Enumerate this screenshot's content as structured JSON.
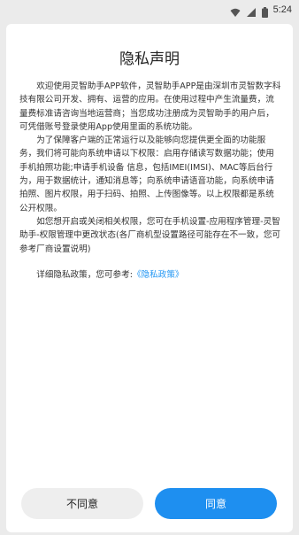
{
  "status_bar": {
    "time": "5:24",
    "icons": [
      "wifi-icon",
      "signal-icon",
      "battery-icon"
    ]
  },
  "dialog": {
    "title": "隐私声明",
    "paragraphs": [
      "欢迎使用灵智助手APP软件，灵智助手APP是由深圳市灵智数字科技有限公司开发、拥有、运营的应用。在使用过程中产生流量费，流量费标准请咨询当地运营商；当您成功注册成为灵智助手的用户后，可凭借账号登录使用App使用里面的系统功能。",
      "为了保障客户端的正常运行以及能够向您提供更全面的功能服务，我们将可能向系统申请以下权限：启用存储读写数据功能；使用手机拍照功能;申请手机设备 信息，包括IMEI(IMSI)、MAC等后台行为，用于数据统计，通知消息等；向系统申请语音功能，向系统申请拍照、图片权限，用于扫码、拍照、上传图像等。以上权限都是系统公开权限。",
      "如您想开启或关闭相关权限，您可在手机设置-应用程序管理-灵智助手-权限管理中更改状态(各厂商机型设置路径可能存在不一致，您可参考厂商设置说明)"
    ],
    "detail_prefix": "详细隐私政策，您可参考:",
    "detail_link": "《隐私政策》",
    "disagree_label": "不同意",
    "agree_label": "同意"
  },
  "colors": {
    "background": "#ebebeb",
    "dialog": "#ffffff",
    "accent": "#1e8ff0",
    "link": "#2196f3"
  }
}
